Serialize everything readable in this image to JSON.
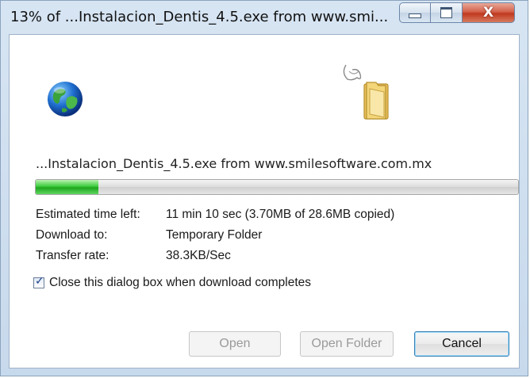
{
  "window": {
    "title": "13% of ...Instalacion_Dentis_4.5.exe from www.smi...",
    "close_glyph": "X"
  },
  "download": {
    "file_line": "...Instalacion_Dentis_4.5.exe from www.smilesoftware.com.mx",
    "progress_fraction": 0.13,
    "estimated_label": "Estimated time left:",
    "estimated_value": "11 min 10 sec (3.70MB of 28.6MB copied)",
    "download_to_label": "Download to:",
    "download_to_value": "Temporary Folder",
    "transfer_label": "Transfer rate:",
    "transfer_value": "38.3KB/Sec",
    "close_when_done_label": "Close this dialog box when download completes",
    "close_when_done_checked": true
  },
  "buttons": {
    "open": "Open",
    "open_folder": "Open Folder",
    "cancel": "Cancel"
  },
  "icons": {
    "globe": "globe-icon",
    "folder": "folder-icon",
    "minimize": "minimize-icon",
    "maximize": "maximize-icon",
    "close": "close-icon"
  },
  "colors": {
    "progress_fill": "#2cc42c",
    "title_close": "#c7432a"
  }
}
